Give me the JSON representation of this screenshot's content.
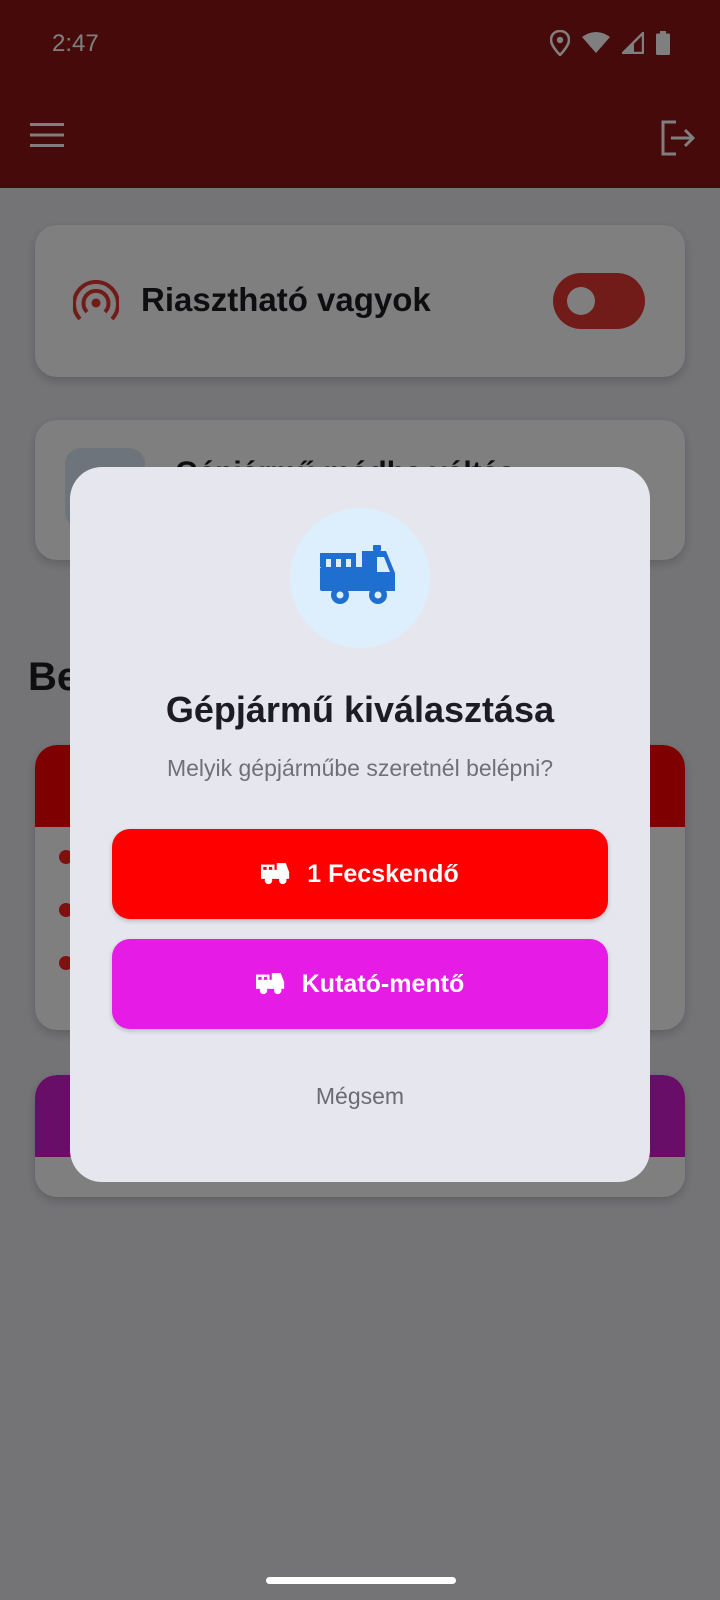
{
  "status_bar": {
    "time": "2:47",
    "icons": [
      "location-icon",
      "wifi-icon",
      "signal-icon",
      "battery-icon"
    ]
  },
  "app_bar": {
    "menu_icon": "menu-icon",
    "logout_icon": "logout-icon",
    "background_color": "#8e1414"
  },
  "alert_card": {
    "label": "Riasztható vagyok",
    "icon": "broadcast-icon",
    "toggle_on": true,
    "toggle_color": "#e53935"
  },
  "vehicle_card": {
    "label": "Gépjármű módba váltás"
  },
  "section": {
    "title": "Be"
  },
  "dialog": {
    "icon": "fire-truck-icon",
    "title": "Gépjármű kiválasztása",
    "subtitle": "Melyik gépjárműbe szeretnél belépni?",
    "options": [
      {
        "label": "1 Fecskendő",
        "icon": "fire-truck-icon",
        "color": "#ff0000"
      },
      {
        "label": "Kutató-mentő",
        "icon": "fire-truck-icon",
        "color": "#e61be6"
      }
    ],
    "cancel_label": "Mégsem"
  }
}
